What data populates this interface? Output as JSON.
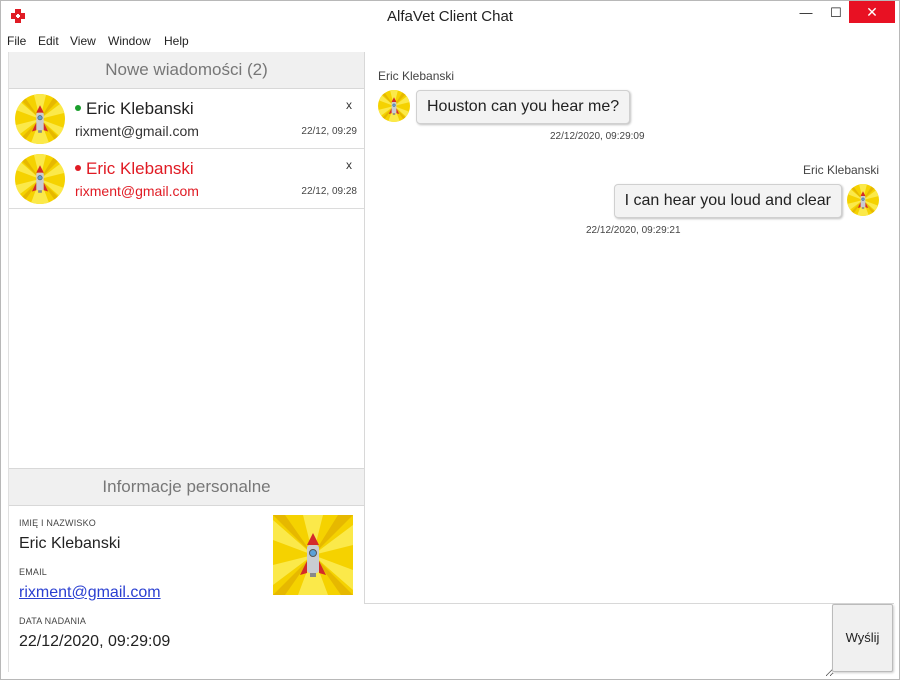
{
  "window": {
    "title": "AlfaVet Client Chat",
    "minimize": "—",
    "maximize": "☐",
    "close": "✕"
  },
  "menu": {
    "items": [
      "File",
      "Edit",
      "View",
      "Window",
      "Help"
    ]
  },
  "conversations": {
    "header": "Nowe wiadomości (2)",
    "items": [
      {
        "name": "Eric Klebanski",
        "email": "rixment@gmail.com",
        "time": "22/12, 09:29",
        "close": "x",
        "status_color": "#1a9e2c",
        "unread": false
      },
      {
        "name": "Eric Klebanski",
        "email": "rixment@gmail.com",
        "time": "22/12, 09:28",
        "close": "x",
        "status_color": "#e01b24",
        "unread": true
      }
    ]
  },
  "personal": {
    "header": "Informacje personalne",
    "name_label": "IMIĘ I NAZWISKO",
    "name": "Eric Klebanski",
    "email_label": "EMAIL",
    "email": "rixment@gmail.com",
    "date_label": "DATA NADANIA",
    "date": "22/12/2020, 09:29:09"
  },
  "chat": {
    "messages": [
      {
        "sender": "Eric Klebanski",
        "text": "Houston can you hear me?",
        "time": "22/12/2020, 09:29:09",
        "side": "left"
      },
      {
        "sender": "Eric Klebanski",
        "text": "I can hear you loud and clear",
        "time": "22/12/2020, 09:29:21",
        "side": "right"
      }
    ]
  },
  "composer": {
    "placeholder": "",
    "send_label": "Wyślij"
  },
  "icons": {
    "app": "alfavet-logo-icon",
    "avatar": "rocket-avatar-icon"
  },
  "colors": {
    "accent_red": "#e01b24",
    "online_green": "#1a9e2c",
    "link_blue": "#2a3fd1",
    "avatar_yellow": "#f5d200"
  }
}
